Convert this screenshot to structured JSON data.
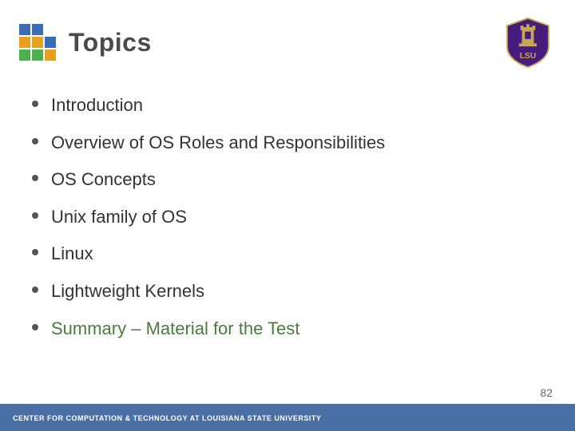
{
  "header": {
    "title": "Topics",
    "logo_alt": "CCT Logo",
    "lsu_alt": "LSU Logo"
  },
  "cct_logo": {
    "cells": [
      {
        "color": "#3a6db5"
      },
      {
        "color": "#3a6db5"
      },
      {
        "color": "#ffffff"
      },
      {
        "color": "#e8a020"
      },
      {
        "color": "#e8a020"
      },
      {
        "color": "#3a6db5"
      },
      {
        "color": "#4caf50"
      },
      {
        "color": "#4caf50"
      },
      {
        "color": "#e8a020"
      }
    ]
  },
  "bullets": [
    {
      "text": "Introduction",
      "highlight": false
    },
    {
      "text": "Overview of OS Roles and Responsibilities",
      "highlight": false
    },
    {
      "text": "OS Concepts",
      "highlight": false
    },
    {
      "text": "Unix family of OS",
      "highlight": false
    },
    {
      "text": "Linux",
      "highlight": false
    },
    {
      "text": "Lightweight Kernels",
      "highlight": false
    },
    {
      "text": "Summary – Material for the Test",
      "highlight": true
    }
  ],
  "footer": {
    "text": "CENTER FOR COMPUTATION & TECHNOLOGY AT LOUISIANA STATE UNIVERSITY"
  },
  "page_number": "82"
}
